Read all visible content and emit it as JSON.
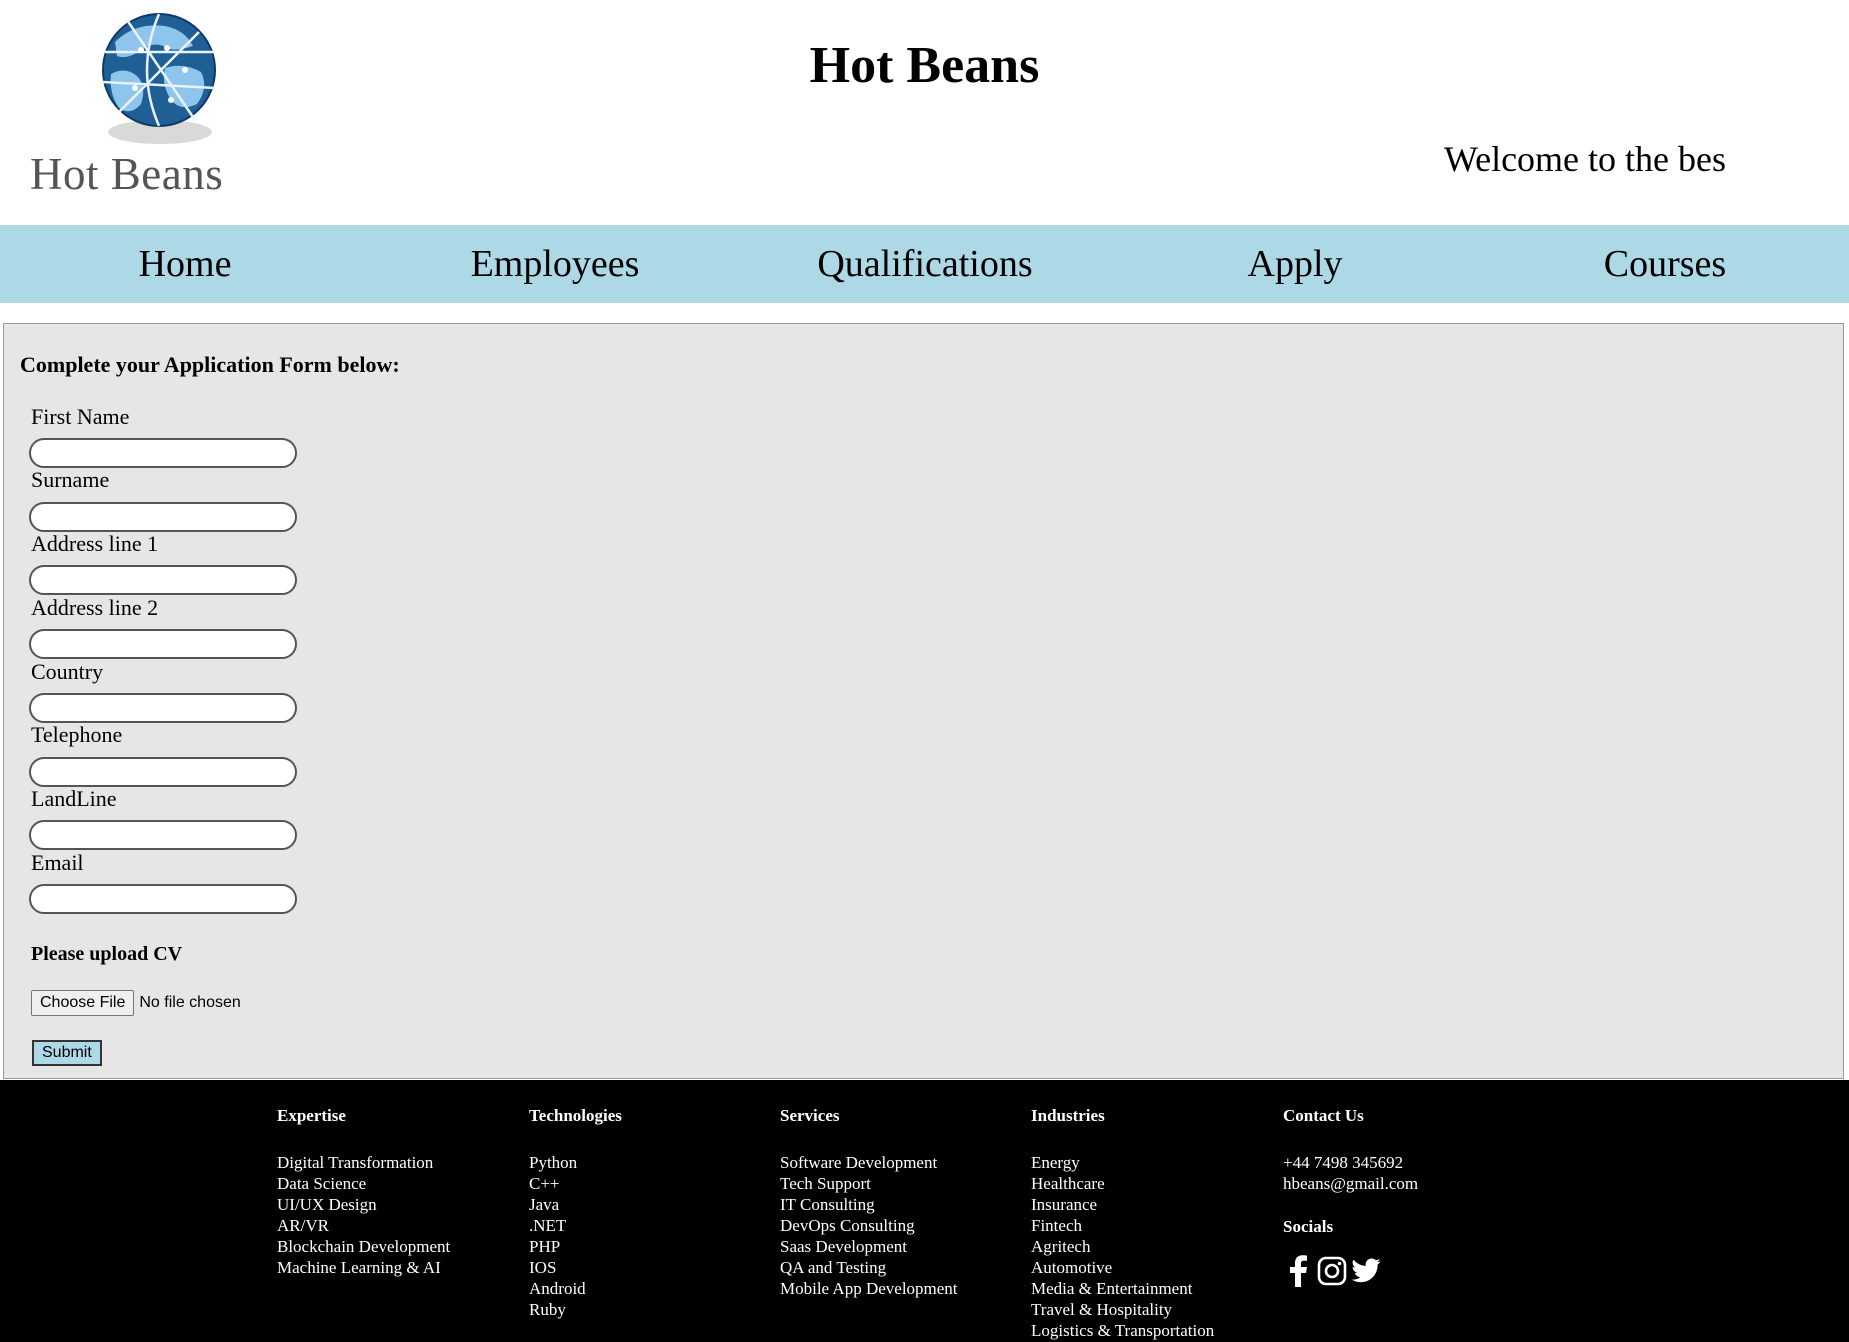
{
  "header": {
    "logo_text": "Hot Beans",
    "site_title": "Hot Beans",
    "ticker_text": "Welcome to the bes"
  },
  "nav": {
    "items": [
      {
        "label": "Home"
      },
      {
        "label": "Employees"
      },
      {
        "label": "Qualifications"
      },
      {
        "label": "Apply"
      },
      {
        "label": "Courses"
      }
    ]
  },
  "form": {
    "heading": "Complete your Application Form below:",
    "fields": [
      {
        "label": "First Name",
        "value": ""
      },
      {
        "label": "Surname",
        "value": ""
      },
      {
        "label": "Address line 1",
        "value": ""
      },
      {
        "label": "Address line 2",
        "value": ""
      },
      {
        "label": "Country",
        "value": ""
      },
      {
        "label": "Telephone",
        "value": ""
      },
      {
        "label": "LandLine",
        "value": ""
      },
      {
        "label": "Email",
        "value": ""
      }
    ],
    "upload_heading": "Please upload CV",
    "file_button_label": "Choose File",
    "file_status": "No file chosen",
    "submit_label": "Submit"
  },
  "footer": {
    "columns": [
      {
        "title": "Expertise",
        "items": [
          "Digital Transformation",
          "Data Science",
          "UI/UX Design",
          "AR/VR",
          "Blockchain Development",
          "Machine Learning & AI"
        ]
      },
      {
        "title": "Technologies",
        "items": [
          "Python",
          "C++",
          "Java",
          ".NET",
          "PHP",
          "IOS",
          "Android",
          "Ruby"
        ]
      },
      {
        "title": "Services",
        "items": [
          "Software Development",
          "Tech Support",
          "IT Consulting",
          "DevOps Consulting",
          "Saas Development",
          "QA and Testing",
          "Mobile App Development"
        ]
      },
      {
        "title": "Industries",
        "items": [
          "Energy",
          "Healthcare",
          "Insurance",
          "Fintech",
          "Agritech",
          "Automotive",
          "Media & Entertainment",
          "Travel & Hospitality",
          "Logistics & Transportation"
        ]
      }
    ],
    "contact": {
      "title": "Contact Us",
      "phone": "+44 7498 345692",
      "email": "hbeans@gmail.com",
      "socials_title": "Socials",
      "social_icons": [
        "facebook-icon",
        "instagram-icon",
        "twitter-icon"
      ]
    }
  },
  "colors": {
    "nav_background": "#add8e6",
    "form_background": "#e6e6e6",
    "footer_background": "#000000",
    "submit_background": "#add8e6"
  }
}
